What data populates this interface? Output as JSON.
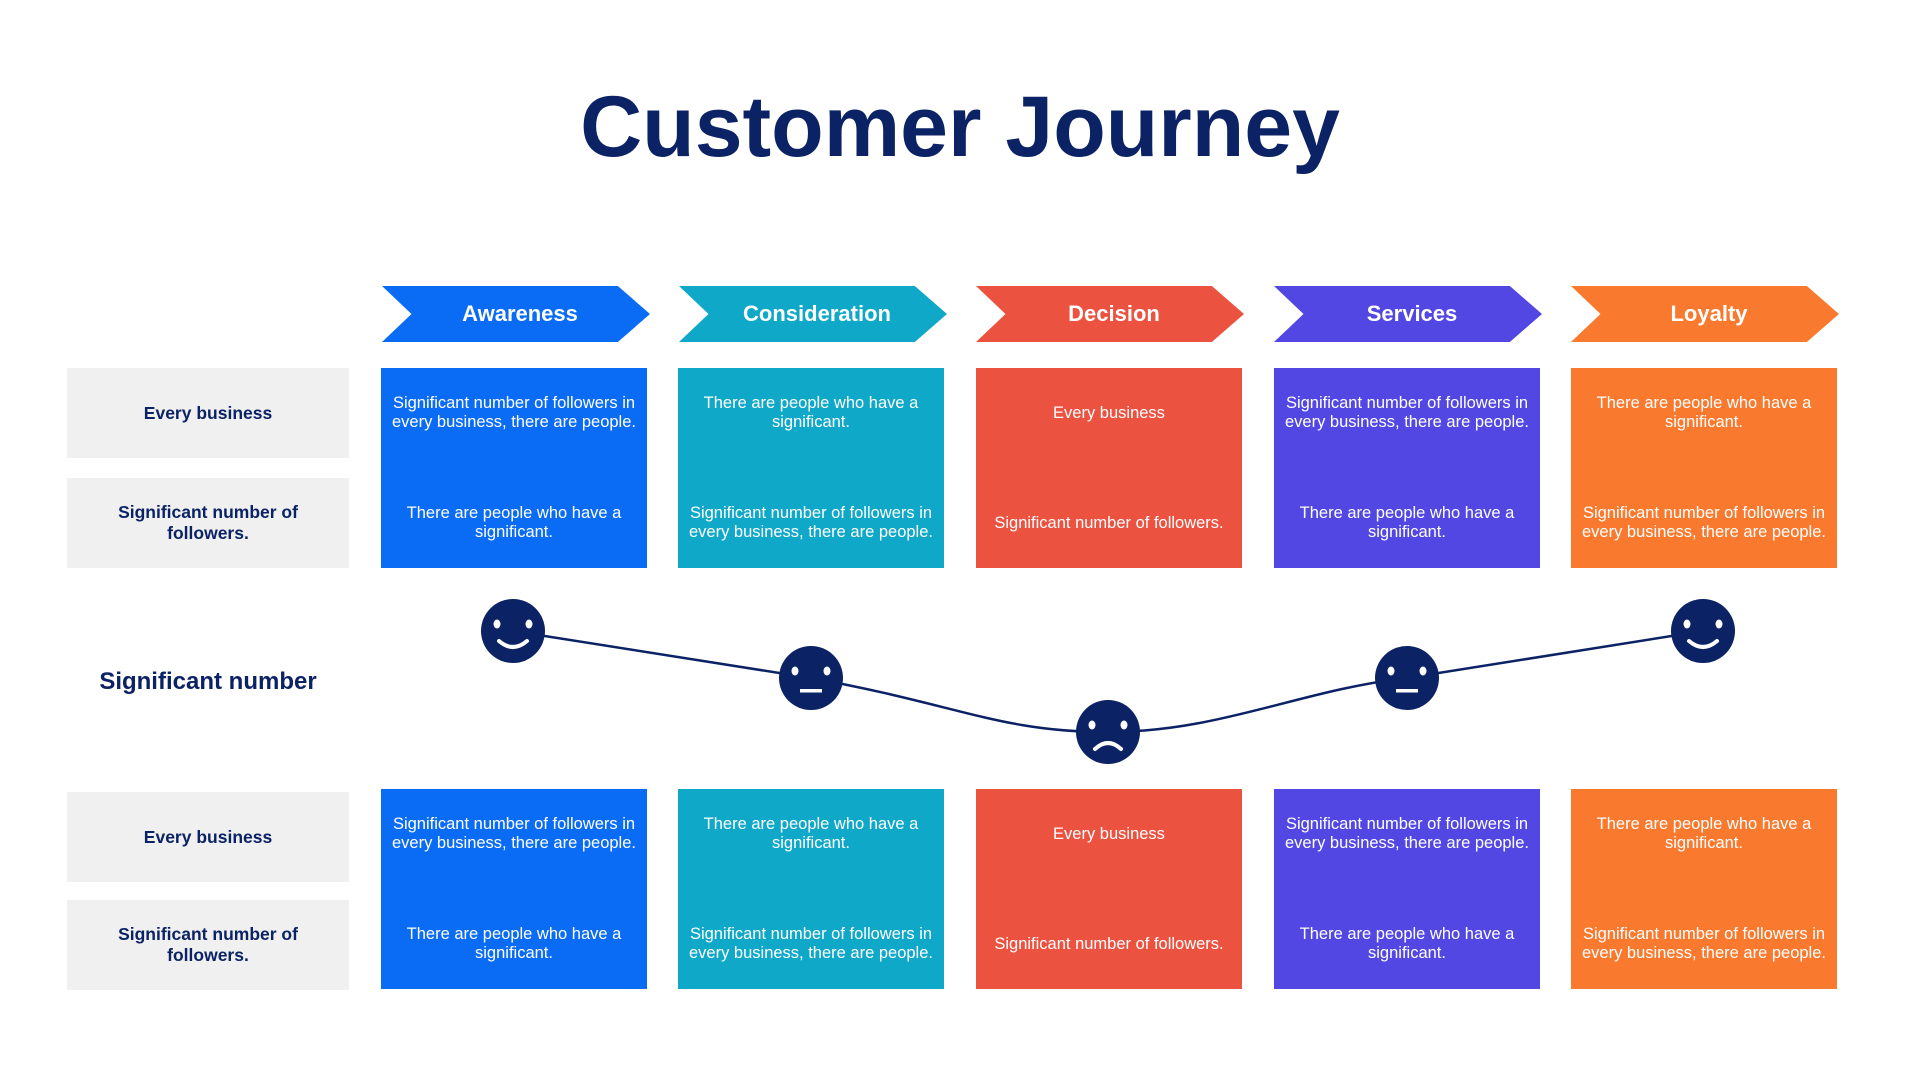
{
  "title": "Customer Journey",
  "colors": {
    "navy": "#0B2265",
    "stages": [
      "#0A6CF5",
      "#0FA8C8",
      "#EB5240",
      "#5347E3",
      "#F97A2E"
    ],
    "label_bg": "#F0F0F0"
  },
  "stages": [
    {
      "name": "Awareness",
      "sentiment": "happy"
    },
    {
      "name": "Consideration",
      "sentiment": "neutral"
    },
    {
      "name": "Decision",
      "sentiment": "sad"
    },
    {
      "name": "Services",
      "sentiment": "neutral"
    },
    {
      "name": "Loyalty",
      "sentiment": "happy"
    }
  ],
  "row_labels": {
    "top_1": "Every business",
    "top_2": "Significant number of followers.",
    "middle": "Significant number",
    "bottom_1": "Every business",
    "bottom_2": "Significant number of followers."
  },
  "top_boxes": [
    {
      "line1": "Significant number of followers in every business, there are people.",
      "line2": "There are people who have a significant."
    },
    {
      "line1": "There are people who have a significant.",
      "line2": "Significant number of followers in every business, there are people."
    },
    {
      "line1": "Every business",
      "line2": "Significant number of followers."
    },
    {
      "line1": "Significant number of followers in every business, there are people.",
      "line2": "There are people who have a significant."
    },
    {
      "line1": "There are people who have a significant.",
      "line2": "Significant number of followers in every business, there are people."
    }
  ],
  "bottom_boxes": [
    {
      "line1": "Significant number of followers in every business, there are people.",
      "line2": "There are people who have a significant."
    },
    {
      "line1": "There are people who have a significant.",
      "line2": "Significant number of followers in every business, there are people."
    },
    {
      "line1": "Every business",
      "line2": "Significant number of followers."
    },
    {
      "line1": "Significant number of followers in every business, there are people.",
      "line2": "There are people who have a significant."
    },
    {
      "line1": "There are people who have a significant.",
      "line2": "Significant number of followers in every business, there are people."
    }
  ]
}
